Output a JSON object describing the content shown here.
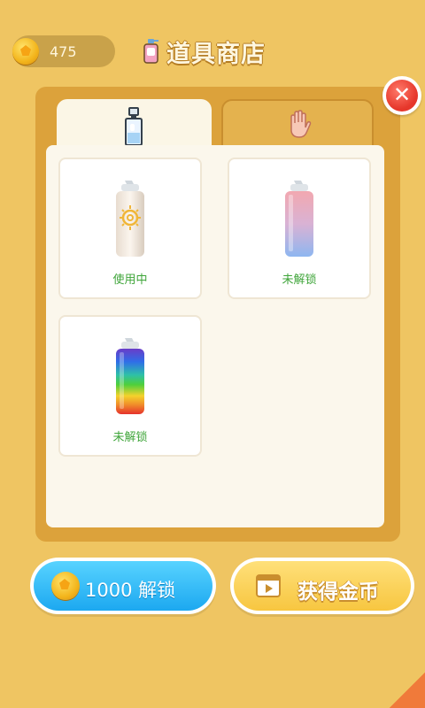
{
  "header": {
    "coins": "475",
    "title": "道具商店"
  },
  "tabs": [
    {
      "icon": "spray-bottle-icon",
      "active": true
    },
    {
      "icon": "hand-icon",
      "active": false
    }
  ],
  "items": [
    {
      "status": "使用中",
      "style": "sun-pattern"
    },
    {
      "status": "未解锁",
      "style": "pink-blue-gradient"
    },
    {
      "status": "未解锁",
      "style": "rainbow-gradient"
    }
  ],
  "buttons": {
    "unlock_label": "1000  解锁",
    "earn_label": "获得金币"
  },
  "colors": {
    "background": "#efc562",
    "panel": "#dca23b",
    "active_status": "#3fa53a",
    "unlock_button": "#1ca8f0",
    "earn_button": "#f7c640",
    "close_button": "#e6372b"
  }
}
